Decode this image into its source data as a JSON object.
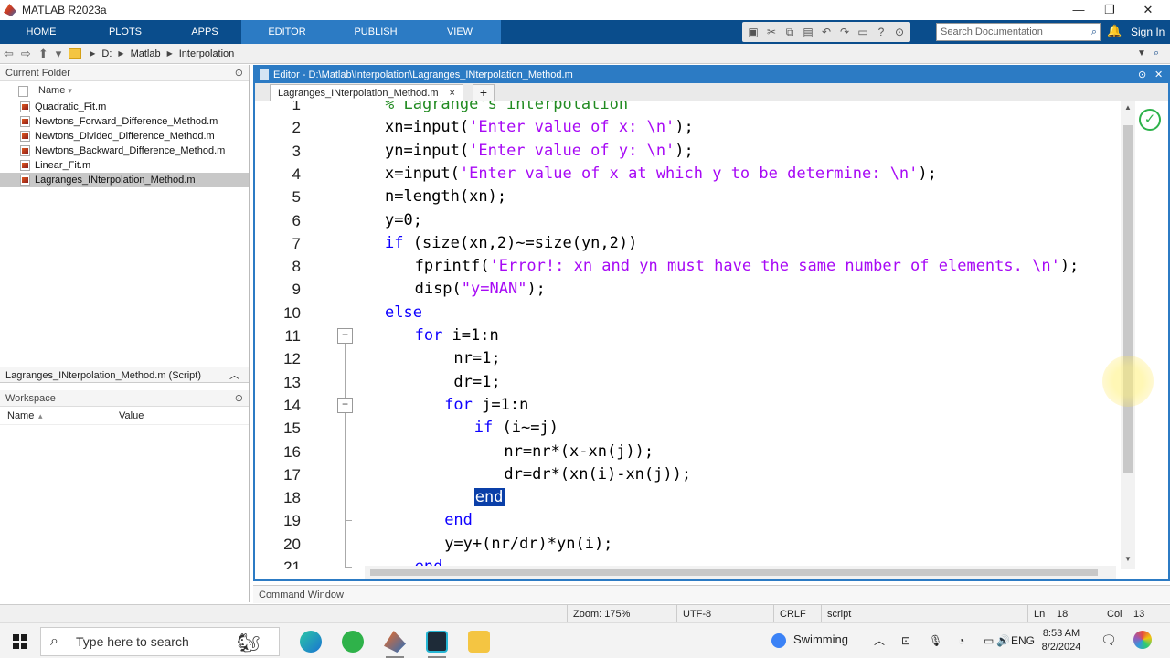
{
  "app": {
    "title": "MATLAB R2023a"
  },
  "ribbon": {
    "tabs": [
      "HOME",
      "PLOTS",
      "APPS",
      "EDITOR",
      "PUBLISH",
      "VIEW"
    ],
    "active_tab": "EDITOR",
    "search_placeholder": "Search Documentation",
    "sign_in": "Sign In"
  },
  "address": {
    "crumbs": [
      "D:",
      "Matlab",
      "Interpolation"
    ]
  },
  "current_folder": {
    "title": "Current Folder",
    "column": "Name",
    "files": [
      "Quadratic_Fit.m",
      "Newtons_Forward_Difference_Method.m",
      "Newtons_Divided_Difference_Method.m",
      "Newtons_Backward_Difference_Method.m",
      "Linear_Fit.m",
      "Lagranges_INterpolation_Method.m"
    ],
    "selected_index": 5,
    "details": "Lagranges_INterpolation_Method.m  (Script)"
  },
  "workspace": {
    "title": "Workspace",
    "col_name": "Name",
    "col_value": "Value"
  },
  "editor": {
    "title": "Editor - D:\\Matlab\\Interpolation\\Lagranges_INterpolation_Method.m",
    "tab": "Lagranges_INterpolation_Method.m",
    "tab_close": "×",
    "tab_add": "+",
    "lines": [
      {
        "n": "1",
        "indent": 0,
        "parts": [
          {
            "t": "% Lagrange's interpolation",
            "c": "cmt"
          }
        ]
      },
      {
        "n": "2",
        "indent": 0,
        "parts": [
          {
            "t": "xn=input(",
            "c": ""
          },
          {
            "t": "'Enter value of x: \\n'",
            "c": "str"
          },
          {
            "t": ");",
            "c": ""
          }
        ]
      },
      {
        "n": "3",
        "indent": 0,
        "parts": [
          {
            "t": "yn=input(",
            "c": ""
          },
          {
            "t": "'Enter value of y: \\n'",
            "c": "str"
          },
          {
            "t": ");",
            "c": ""
          }
        ]
      },
      {
        "n": "4",
        "indent": 0,
        "parts": [
          {
            "t": "x=input(",
            "c": ""
          },
          {
            "t": "'Enter value of x at which y to be determine: \\n'",
            "c": "str"
          },
          {
            "t": ");",
            "c": ""
          }
        ]
      },
      {
        "n": "5",
        "indent": 0,
        "parts": [
          {
            "t": "n=length(xn);",
            "c": ""
          }
        ]
      },
      {
        "n": "6",
        "indent": 0,
        "parts": [
          {
            "t": "y=0;",
            "c": ""
          }
        ]
      },
      {
        "n": "7",
        "indent": 0,
        "parts": [
          {
            "t": "if",
            "c": "kw"
          },
          {
            "t": " (size(xn,2)~=size(yn,2))",
            "c": ""
          }
        ]
      },
      {
        "n": "8",
        "indent": 2,
        "parts": [
          {
            "t": "fprintf(",
            "c": ""
          },
          {
            "t": "'Error!: xn and yn must have the same number of elements. \\n'",
            "c": "str"
          },
          {
            "t": ");",
            "c": ""
          }
        ]
      },
      {
        "n": "9",
        "indent": 2,
        "parts": [
          {
            "t": "disp(",
            "c": ""
          },
          {
            "t": "\"y=NAN\"",
            "c": "str"
          },
          {
            "t": ");",
            "c": ""
          }
        ]
      },
      {
        "n": "10",
        "indent": 0,
        "parts": [
          {
            "t": "else",
            "c": "kw"
          }
        ]
      },
      {
        "n": "11",
        "indent": 2,
        "parts": [
          {
            "t": "for",
            "c": "kw"
          },
          {
            "t": " i=1:n",
            "c": ""
          }
        ]
      },
      {
        "n": "12",
        "indent": 4,
        "parts": [
          {
            "t": " nr=1;",
            "c": ""
          }
        ]
      },
      {
        "n": "13",
        "indent": 4,
        "parts": [
          {
            "t": " dr=1;",
            "c": ""
          }
        ]
      },
      {
        "n": "14",
        "indent": 4,
        "parts": [
          {
            "t": "for",
            "c": "kw"
          },
          {
            "t": " j=1:n",
            "c": ""
          }
        ]
      },
      {
        "n": "15",
        "indent": 6,
        "parts": [
          {
            "t": "if",
            "c": "kw"
          },
          {
            "t": " (i~=j)",
            "c": ""
          }
        ]
      },
      {
        "n": "16",
        "indent": 8,
        "parts": [
          {
            "t": "nr=nr*(x-xn(j));",
            "c": ""
          }
        ]
      },
      {
        "n": "17",
        "indent": 8,
        "parts": [
          {
            "t": "dr=dr*(xn(i)-xn(j));",
            "c": ""
          }
        ]
      },
      {
        "n": "18",
        "indent": 6,
        "parts": [
          {
            "t": "end",
            "c": "hl"
          }
        ]
      },
      {
        "n": "19",
        "indent": 4,
        "parts": [
          {
            "t": "end",
            "c": "kw"
          }
        ]
      },
      {
        "n": "20",
        "indent": 4,
        "parts": [
          {
            "t": "y=y+(nr/dr)*yn(i);",
            "c": ""
          }
        ]
      },
      {
        "n": "21",
        "indent": 2,
        "parts": [
          {
            "t": "end",
            "c": "kw"
          }
        ]
      }
    ]
  },
  "command_window": {
    "title": "Command Window"
  },
  "status": {
    "zoom": "Zoom: 175%",
    "encoding": "UTF-8",
    "eol": "CRLF",
    "type": "script",
    "ln_label": "Ln",
    "ln": "18",
    "col_label": "Col",
    "col": "13"
  },
  "taskbar": {
    "search_placeholder": "Type here to search",
    "weather": "Swimming",
    "lang": "ENG",
    "time": "8:53 AM",
    "date": "8/2/2024"
  }
}
